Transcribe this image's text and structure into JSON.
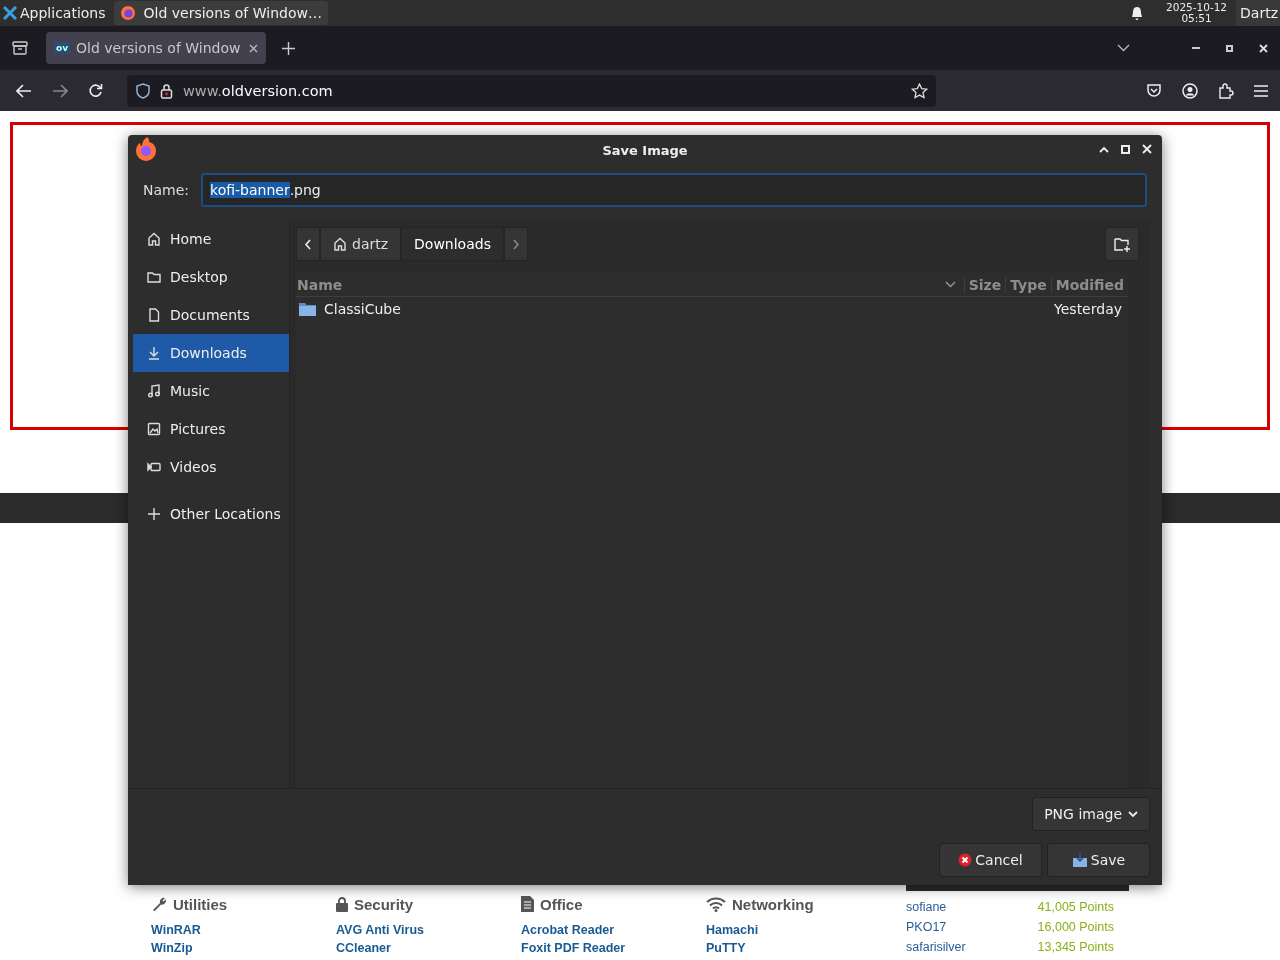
{
  "panel": {
    "applications": "Applications",
    "task": "Old versions of Window…",
    "date": "2025-10-12",
    "time": "05:51",
    "user": "Dartz"
  },
  "browser": {
    "tabs": [
      {
        "favicon": "ov",
        "title": "Old versions of Window",
        "selected": true
      }
    ],
    "url_prefix": "www.",
    "url_domain": "oldversion.com"
  },
  "dialog": {
    "title": "Save Image",
    "name_label": "Name:",
    "file_name_selected": "kofi-banner",
    "file_name_rest": ".png",
    "places": [
      {
        "label": "Home",
        "kind": "home",
        "selected": false
      },
      {
        "label": "Desktop",
        "kind": "folder",
        "selected": false
      },
      {
        "label": "Documents",
        "kind": "document",
        "selected": false
      },
      {
        "label": "Downloads",
        "kind": "download",
        "selected": true
      },
      {
        "label": "Music",
        "kind": "music",
        "selected": false
      },
      {
        "label": "Pictures",
        "kind": "picture",
        "selected": false
      },
      {
        "label": "Videos",
        "kind": "video",
        "selected": false
      },
      {
        "label": "Other Locations",
        "kind": "other",
        "selected": false
      }
    ],
    "path": [
      {
        "label": "dartz",
        "kind": "home",
        "selected": false
      },
      {
        "label": "Downloads",
        "kind": "plain",
        "selected": true
      }
    ],
    "columns": [
      "Name",
      "Size",
      "Type",
      "Modified"
    ],
    "files": [
      {
        "name": "ClassiCube",
        "modified": "Yesterday"
      }
    ],
    "file_type": "PNG image",
    "buttons": [
      {
        "label": "Cancel",
        "kind": "cancel"
      },
      {
        "label": "Save",
        "kind": "save"
      }
    ]
  },
  "page": {
    "categories": [
      {
        "title": "Utilities",
        "kind": "wrench",
        "links": [
          "WinRAR",
          "WinZip"
        ]
      },
      {
        "title": "Security",
        "kind": "lock",
        "links": [
          "AVG Anti Virus",
          "CCleaner"
        ]
      },
      {
        "title": "Office",
        "kind": "document",
        "links": [
          "Acrobat Reader",
          "Foxit PDF Reader"
        ]
      },
      {
        "title": "Networking",
        "kind": "wifi",
        "links": [
          "Hamachi",
          "PuTTY"
        ]
      }
    ],
    "contributors": [
      {
        "name": "sofiane",
        "points": "41,005 Points"
      },
      {
        "name": "PKO17",
        "points": "16,000 Points"
      },
      {
        "name": "safarisilver",
        "points": "13,345 Points"
      }
    ]
  }
}
